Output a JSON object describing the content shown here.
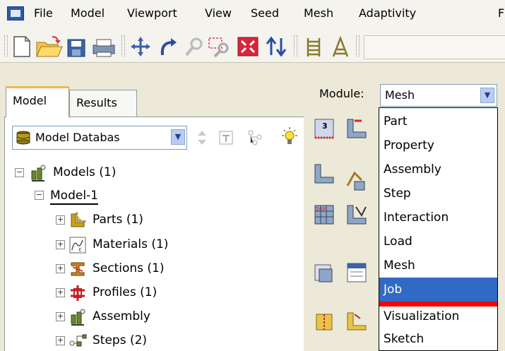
{
  "menu": {
    "items": [
      "File",
      "Model",
      "Viewport",
      "View",
      "Seed",
      "Mesh",
      "Adaptivity",
      "F"
    ]
  },
  "toolbar": {
    "icons": [
      "new-file-icon",
      "open-folder-icon",
      "save-icon",
      "print-icon",
      "pan-icon",
      "rotate-icon",
      "zoom-icon",
      "box-zoom-icon",
      "auto-fit-icon",
      "cycle-views-icon",
      "mesh-rows-icon",
      "mesh-truss-icon"
    ]
  },
  "left": {
    "tabs": {
      "model": "Model",
      "results": "Results"
    },
    "database": {
      "selected": "Model Databas"
    },
    "tree": [
      {
        "label": "Models (1)",
        "icon": "models-icon",
        "expander": "−"
      },
      {
        "label": "Model-1",
        "icon": "",
        "expander": "−"
      },
      {
        "label": "Parts (1)",
        "icon": "parts-icon",
        "expander": "+"
      },
      {
        "label": "Materials (1)",
        "icon": "materials-icon",
        "expander": "+"
      },
      {
        "label": "Sections (1)",
        "icon": "sections-icon",
        "expander": "+"
      },
      {
        "label": "Profiles (1)",
        "icon": "profiles-icon",
        "expander": "+"
      },
      {
        "label": "Assembly",
        "icon": "assembly-icon",
        "expander": "+"
      },
      {
        "label": "Steps (2)",
        "icon": "steps-icon",
        "expander": "+"
      }
    ]
  },
  "module": {
    "label": "Module:",
    "selected": "Mesh",
    "options": [
      "Part",
      "Property",
      "Assembly",
      "Step",
      "Interaction",
      "Load",
      "Mesh",
      "Job",
      "Visualization",
      "Sketch"
    ],
    "highlighted": "Job"
  },
  "colors": {
    "highlight": "#316ac5",
    "red_mark": "#ff0000",
    "tab_accent": "#f3b74c"
  }
}
